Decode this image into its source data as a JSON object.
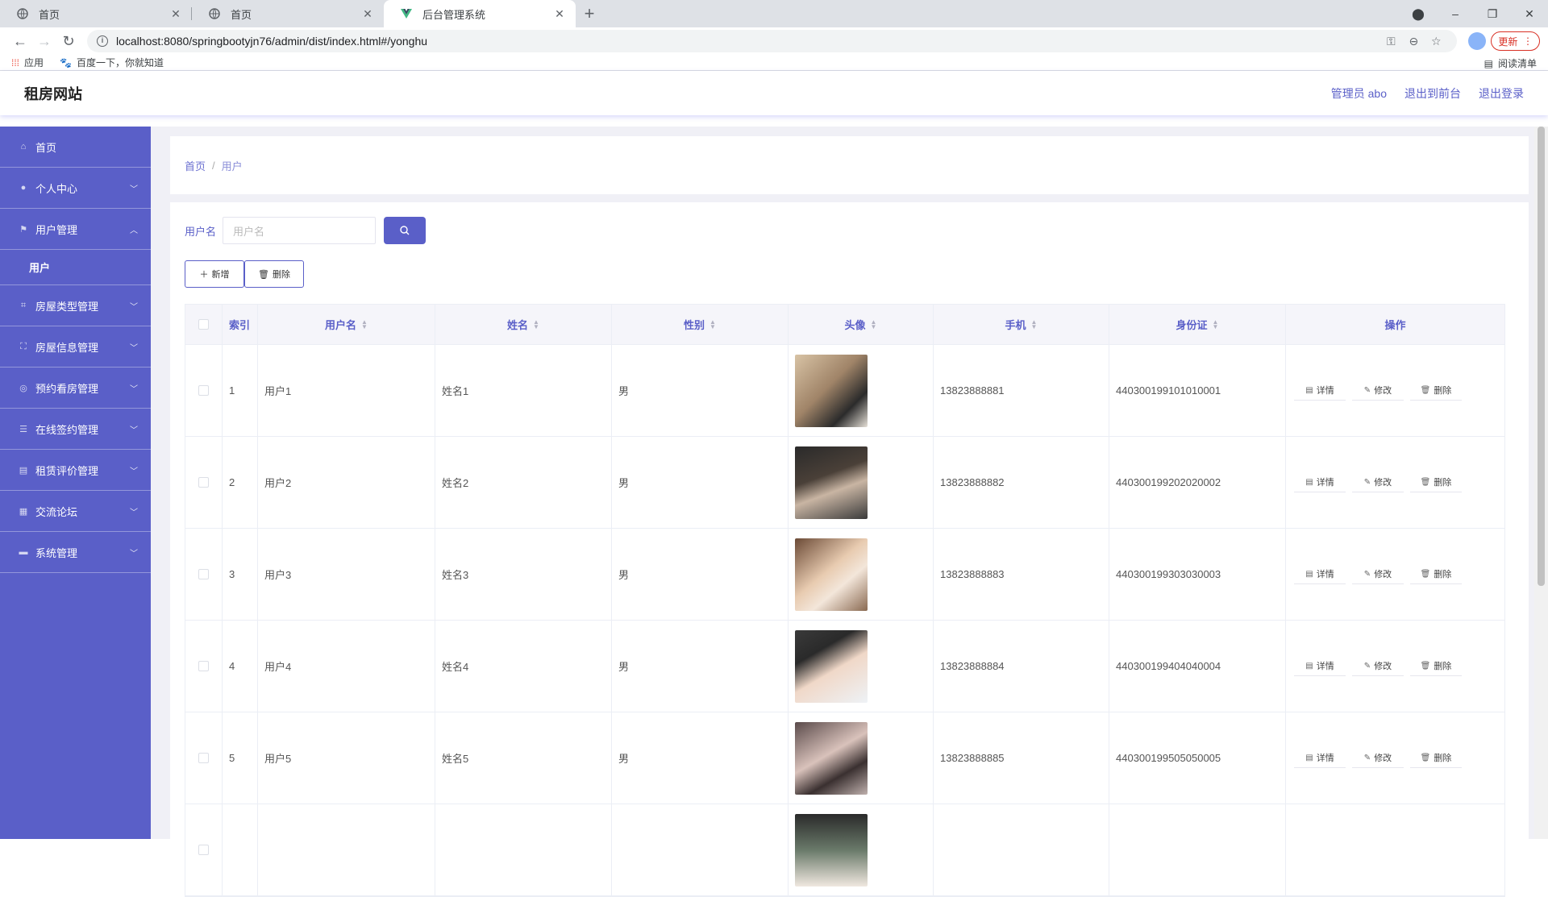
{
  "browser": {
    "tabs": [
      {
        "title": "首页",
        "icon": "globe-icon"
      },
      {
        "title": "首页",
        "icon": "globe-icon"
      },
      {
        "title": "后台管理系统",
        "icon": "vue-logo-icon"
      }
    ],
    "url": "localhost:8080/springbootyjn76/admin/dist/index.html#/yonghu",
    "update_label": "更新",
    "bookmarks": [
      {
        "label": "应用",
        "icon": "apps-grid-icon"
      },
      {
        "label": "百度一下，你就知道",
        "icon": "baidu-paw-icon"
      }
    ],
    "reading_list": "阅读清单"
  },
  "header": {
    "title": "租房网站",
    "admin_label": "管理员 abo",
    "to_front": "退出到前台",
    "logout": "退出登录"
  },
  "sidebar": {
    "items": [
      {
        "label": "首页",
        "icon": "home-icon",
        "expandable": false
      },
      {
        "label": "个人中心",
        "icon": "user-icon",
        "expandable": true
      },
      {
        "label": "用户管理",
        "icon": "flag-icon",
        "expandable": true,
        "expanded": true
      },
      {
        "label": "房屋类型管理",
        "icon": "crop-icon",
        "expandable": true
      },
      {
        "label": "房屋信息管理",
        "icon": "fullscreen-icon",
        "expandable": true
      },
      {
        "label": "预约看房管理",
        "icon": "compass-icon",
        "expandable": true
      },
      {
        "label": "在线签约管理",
        "icon": "sliders-icon",
        "expandable": true
      },
      {
        "label": "租赁评价管理",
        "icon": "briefcase-icon",
        "expandable": true
      },
      {
        "label": "交流论坛",
        "icon": "document-icon",
        "expandable": true
      },
      {
        "label": "系统管理",
        "icon": "message-icon",
        "expandable": true
      }
    ],
    "submenu": {
      "label": "用户"
    }
  },
  "breadcrumb": {
    "home": "首页",
    "separator": "/",
    "current": "用户"
  },
  "search": {
    "label": "用户名",
    "placeholder": "用户名"
  },
  "actions": {
    "add": "新增",
    "delete": "删除"
  },
  "table": {
    "headers": [
      "索引",
      "用户名",
      "姓名",
      "性别",
      "头像",
      "手机",
      "身份证",
      "操作"
    ],
    "rows": [
      {
        "index": "1",
        "username": "用户1",
        "name": "姓名1",
        "gender": "男",
        "phone": "13823888881",
        "id_card": "440300199101010001"
      },
      {
        "index": "2",
        "username": "用户2",
        "name": "姓名2",
        "gender": "男",
        "phone": "13823888882",
        "id_card": "440300199202020002"
      },
      {
        "index": "3",
        "username": "用户3",
        "name": "姓名3",
        "gender": "男",
        "phone": "13823888883",
        "id_card": "440300199303030003"
      },
      {
        "index": "4",
        "username": "用户4",
        "name": "姓名4",
        "gender": "男",
        "phone": "13823888884",
        "id_card": "440300199404040004"
      },
      {
        "index": "5",
        "username": "用户5",
        "name": "姓名5",
        "gender": "男",
        "phone": "13823888885",
        "id_card": "440300199505050005"
      },
      {
        "index": "",
        "username": "",
        "name": "",
        "gender": "",
        "phone": "",
        "id_card": ""
      }
    ],
    "row_actions": {
      "detail": "详情",
      "edit": "修改",
      "delete": "删除"
    }
  },
  "colors": {
    "accent": "#5a5fc8",
    "sidebar_bg": "#5a5fc8",
    "content_bg": "#f0f0f6"
  }
}
